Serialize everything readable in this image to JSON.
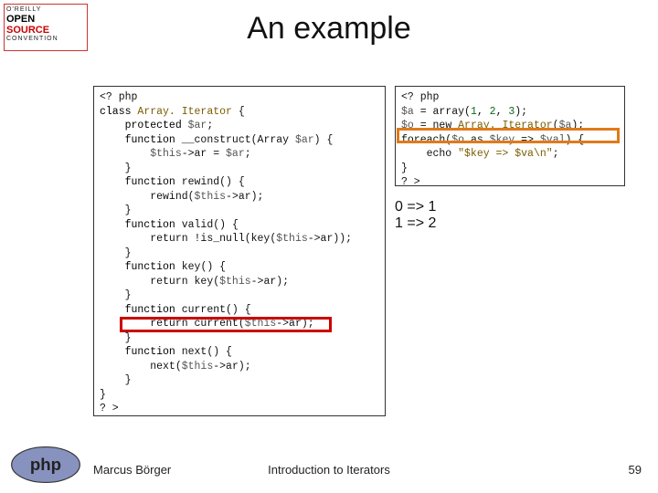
{
  "logo": {
    "line1": "O'REILLY",
    "open": "OPEN",
    "source": "SOURCE",
    "conv": "CONVENTION"
  },
  "title": "An example",
  "code_left": {
    "l01": "<? php",
    "l02a": "class ",
    "l02b": "Array. Iterator ",
    "l02c": "{",
    "l03a": "    protected ",
    "l03b": "$ar",
    "l03c": ";",
    "l04a": "    function ",
    "l04b": "__construct",
    "l04c": "(Array ",
    "l04d": "$ar",
    "l04e": ") {",
    "l05a": "        $this",
    "l05b": "->ar = ",
    "l05c": "$ar",
    "l05d": ";",
    "l06": "    }",
    "l07a": "    function ",
    "l07b": "rewind",
    "l07c": "() {",
    "l08a": "        rewind(",
    "l08b": "$this",
    "l08c": "->ar);",
    "l09": "    }",
    "l10a": "    function ",
    "l10b": "valid",
    "l10c": "() {",
    "l11a": "        return !is_null(key(",
    "l11b": "$this",
    "l11c": "->ar));",
    "l12": "    }",
    "l13a": "    function ",
    "l13b": "key",
    "l13c": "() {",
    "l14a": "        return key(",
    "l14b": "$this",
    "l14c": "->ar);",
    "l15": "    }",
    "l16a": "    function ",
    "l16b": "current",
    "l16c": "() {",
    "l17a": "        return current(",
    "l17b": "$this",
    "l17c": "->ar);",
    "l18": "    }",
    "l19a": "    function ",
    "l19b": "next",
    "l19c": "() {",
    "l20a": "        next(",
    "l20b": "$this",
    "l20c": "->ar);",
    "l21": "    }",
    "l22": "}",
    "l23": "? >"
  },
  "code_right": {
    "l01": "<? php",
    "l02a": "$a ",
    "l02b": "= array(",
    "l02c": "1",
    "l02d": ", ",
    "l02e": "2",
    "l02f": ", ",
    "l02g": "3",
    "l02h": ");",
    "l03a": "$o ",
    "l03b": "= new ",
    "l03c": "Array. Iterator",
    "l03d": "(",
    "l03e": "$a",
    "l03f": ");",
    "l04a": "foreach(",
    "l04b": "$o ",
    "l04c": "as ",
    "l04d": "$key ",
    "l04e": "=> ",
    "l04f": "$val",
    "l04g": ") {",
    "l05a": "    echo ",
    "l05b": "\"$key => $va\\n\"",
    "l05c": ";",
    "l06": "}",
    "l07": "? >"
  },
  "output": {
    "line1": "0 => 1",
    "line2": "1 => 2"
  },
  "footer": {
    "author": "Marcus Börger",
    "center": "Introduction to Iterators",
    "page": "59"
  },
  "php_logo_text": "php"
}
